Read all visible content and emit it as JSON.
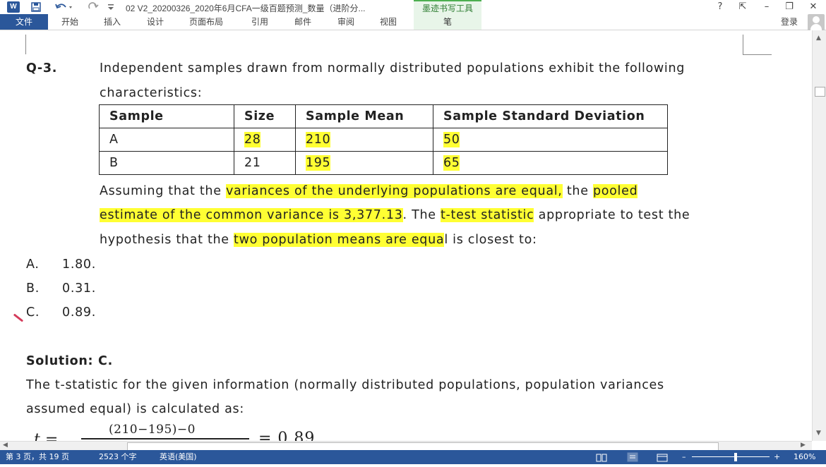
{
  "titlebar": {
    "app_icon": "W",
    "document_title": "02 V2_20200326_2020年6月CFA一级百题预测_数量（进阶分...",
    "contextual_tools": "墨迹书写工具",
    "window_buttons": {
      "help": "?",
      "ribbon_display": "⇱",
      "minimize": "–",
      "restore": "❐",
      "close": "✕"
    }
  },
  "ribbon": {
    "file_tab": "文件",
    "tabs": [
      "开始",
      "插入",
      "设计",
      "页面布局",
      "引用",
      "邮件",
      "审阅",
      "视图"
    ],
    "pen_tab": "笔",
    "login": "登录"
  },
  "document": {
    "question_label": "Q-3.",
    "question_line1": "Independent samples drawn from normally distributed populations exhibit the following",
    "question_line2": "characteristics:",
    "table": {
      "headers": [
        "Sample",
        "Size",
        "Sample Mean",
        "Sample Standard Deviation"
      ],
      "rows": [
        [
          "A",
          "28",
          "210",
          "50"
        ],
        [
          "B",
          "21",
          "195",
          "65"
        ]
      ]
    },
    "para": {
      "l1_a": "Assuming that the ",
      "l1_b": "variances of the underlying populations are equal,",
      "l1_c": " the ",
      "l1_d": "pooled",
      "l2_a": "estimate of the common variance is 3,377.13",
      "l2_b": ". The ",
      "l2_c": "t-test statistic",
      "l2_d": " appropriate to test the",
      "l3_a": "hypothesis that the ",
      "l3_b": "two population means are equa",
      "l3_c": "l is closest to:"
    },
    "options": [
      {
        "letter": "A.",
        "value": "1.80."
      },
      {
        "letter": "B.",
        "value": "0.31."
      },
      {
        "letter": "C.",
        "value": "0.89."
      }
    ],
    "solution_label": "Solution: C.",
    "solution_line1": "The t-statistic for the given information (normally distributed populations, population variances",
    "solution_line2": "assumed equal) is calculated as:",
    "equation": {
      "lhs": "t =",
      "numerator": "(210−195)−0",
      "result": "= 0.89"
    }
  },
  "statusbar": {
    "page": "第 3 页，共 19 页",
    "words": "2523 个字",
    "language": "英语(美国)",
    "zoom": "160%"
  },
  "colors": {
    "accent": "#2b579a",
    "highlight": "#ffff33",
    "ink_tools": "#e8f5e9"
  }
}
